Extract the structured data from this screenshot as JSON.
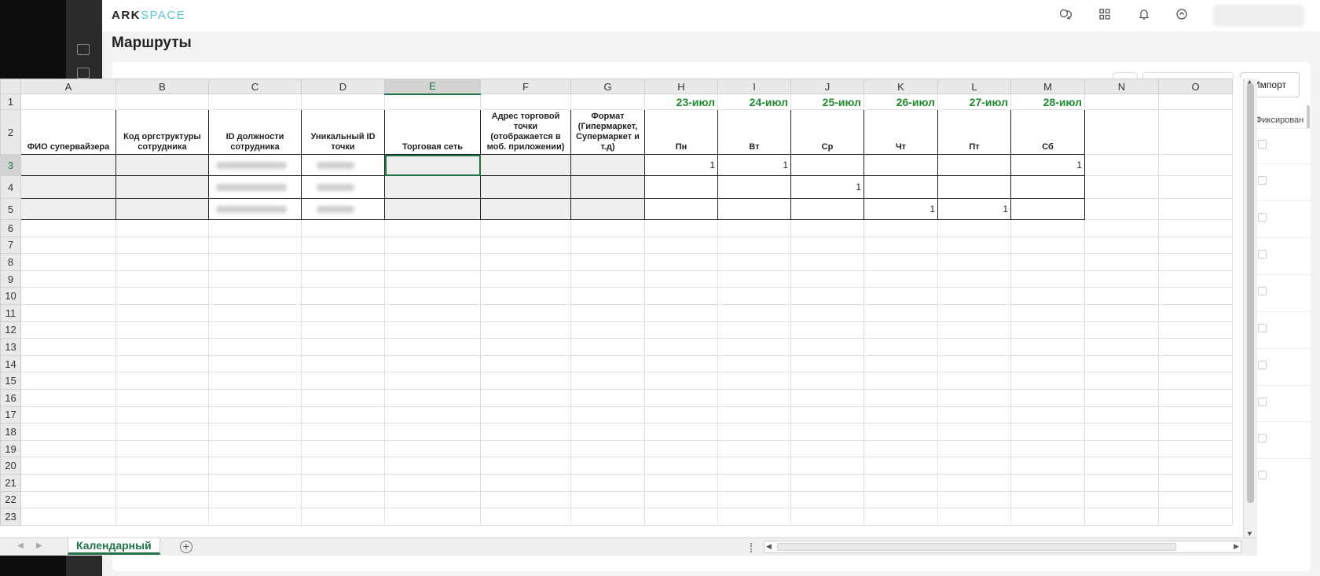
{
  "app": {
    "logo_ark": "ARK",
    "logo_space": "SPACE",
    "page_title": "Маршруты"
  },
  "topbar": {
    "icons": [
      "chat-icon",
      "apps-grid-icon",
      "bell-icon",
      "sync-icon"
    ]
  },
  "toolbar": {
    "import_label": "Импорт"
  },
  "right_panel": {
    "fixed_column_label": "Фиксирован"
  },
  "sheet": {
    "columns": [
      "A",
      "B",
      "C",
      "D",
      "E",
      "F",
      "G",
      "H",
      "I",
      "J",
      "K",
      "L",
      "M",
      "N",
      "O"
    ],
    "selected_column": "E",
    "row_numbers": [
      "1",
      "2",
      "3",
      "4",
      "5",
      "6",
      "7",
      "8",
      "9",
      "10",
      "11",
      "12",
      "13",
      "14",
      "15",
      "16",
      "17",
      "18",
      "19",
      "20",
      "21",
      "22",
      "23"
    ],
    "dates": [
      "23-июл",
      "24-июл",
      "25-июл",
      "26-июл",
      "27-июл",
      "28-июл"
    ],
    "headers": [
      "ФИО супервайзера",
      "Код оргструктуры сотрудника",
      "ID должности сотрудника",
      "Уникальный ID точки",
      "Торговая сеть",
      "Адрес торговой точки (отображается в моб. приложении)",
      "Формат (Гипермаркет, Супермаркет и т.д)"
    ],
    "days": [
      "Пн",
      "Вт",
      "Ср",
      "Чт",
      "Пт",
      "Сб"
    ],
    "data_rows": [
      [
        "1",
        "1",
        "",
        "",
        "",
        "1"
      ],
      [
        "",
        "",
        "1",
        "",
        "",
        ""
      ],
      [
        "",
        "",
        "",
        "1",
        "1",
        ""
      ]
    ],
    "active_cell": "E3",
    "tab_name": "Календарный"
  },
  "colors": {
    "accent_green": "#217346",
    "date_green": "#1e8c2e",
    "logo_cyan": "#5cc6cf"
  }
}
